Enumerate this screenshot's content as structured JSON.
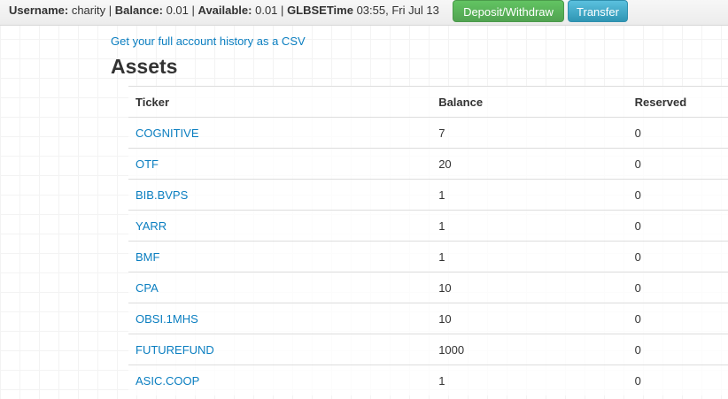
{
  "topbar": {
    "username_label": "Username:",
    "username": "charity",
    "balance_label": "Balance:",
    "balance": "0.01",
    "available_label": "Available:",
    "available": "0.01",
    "time_label": "GLBSETime",
    "time": "03:55, Fri Jul 13",
    "deposit_button": "Deposit/Withdraw",
    "transfer_button": "Transfer"
  },
  "csv_link": "Get your full account history as a CSV",
  "title": "Assets",
  "table": {
    "columns": [
      "Ticker",
      "Balance",
      "Reserved"
    ],
    "rows": [
      {
        "ticker": "COGNITIVE",
        "balance": "7",
        "reserved": "0"
      },
      {
        "ticker": "OTF",
        "balance": "20",
        "reserved": "0"
      },
      {
        "ticker": "BIB.BVPS",
        "balance": "1",
        "reserved": "0"
      },
      {
        "ticker": "YARR",
        "balance": "1",
        "reserved": "0"
      },
      {
        "ticker": "BMF",
        "balance": "1",
        "reserved": "0"
      },
      {
        "ticker": "CPA",
        "balance": "10",
        "reserved": "0"
      },
      {
        "ticker": "OBSI.1MHS",
        "balance": "10",
        "reserved": "0"
      },
      {
        "ticker": "FUTUREFUND",
        "balance": "1000",
        "reserved": "0"
      },
      {
        "ticker": "ASIC.COOP",
        "balance": "1",
        "reserved": "0"
      }
    ]
  },
  "colors": {
    "link": "#0a7ec0",
    "deposit_button": "#5bb75b",
    "transfer_button": "#49afcd"
  }
}
